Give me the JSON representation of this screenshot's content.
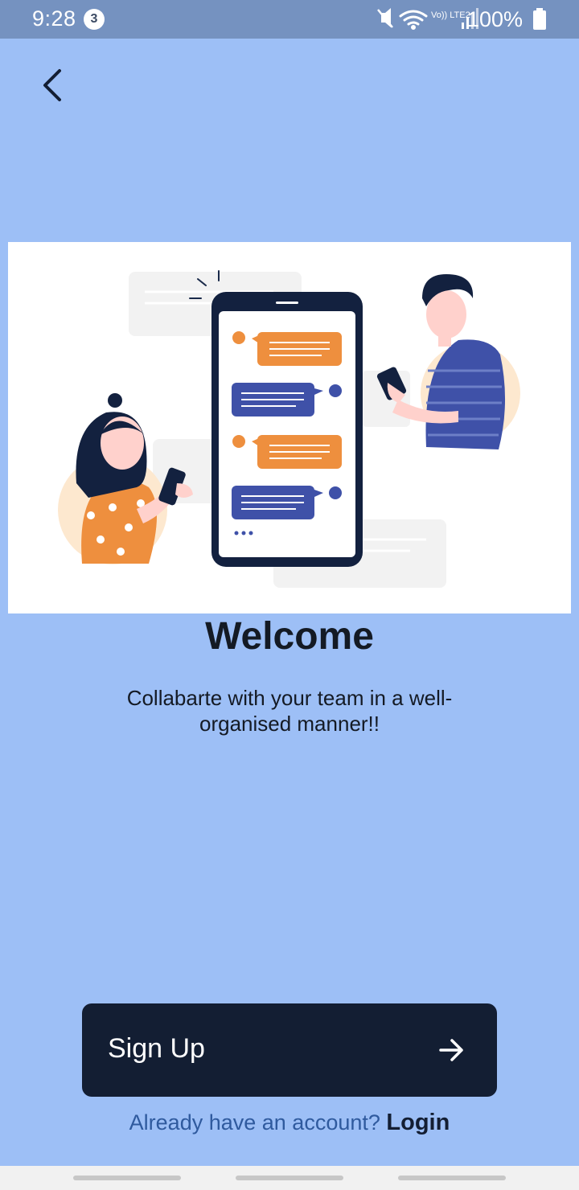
{
  "status_bar": {
    "time": "9:28",
    "notification_count": "3",
    "network_label": "Vo)) LTE2",
    "battery": "100%"
  },
  "icons": {
    "back": "chevron-left-icon",
    "mute": "mute-icon",
    "wifi": "wifi-icon",
    "signal": "signal-icon",
    "battery": "battery-icon",
    "arrow": "arrow-right-icon"
  },
  "main": {
    "title": "Welcome",
    "subtitle": "Collabarte with your team in a well-organised manner!!"
  },
  "actions": {
    "signup_label": "Sign Up",
    "login_prompt": "Already have an account?",
    "login_label": "Login"
  },
  "colors": {
    "background": "#9dbff6",
    "button": "#131e33",
    "status_bar": "#7592c0",
    "accent_orange": "#ee8f3e",
    "accent_blue": "#3f51a8"
  }
}
